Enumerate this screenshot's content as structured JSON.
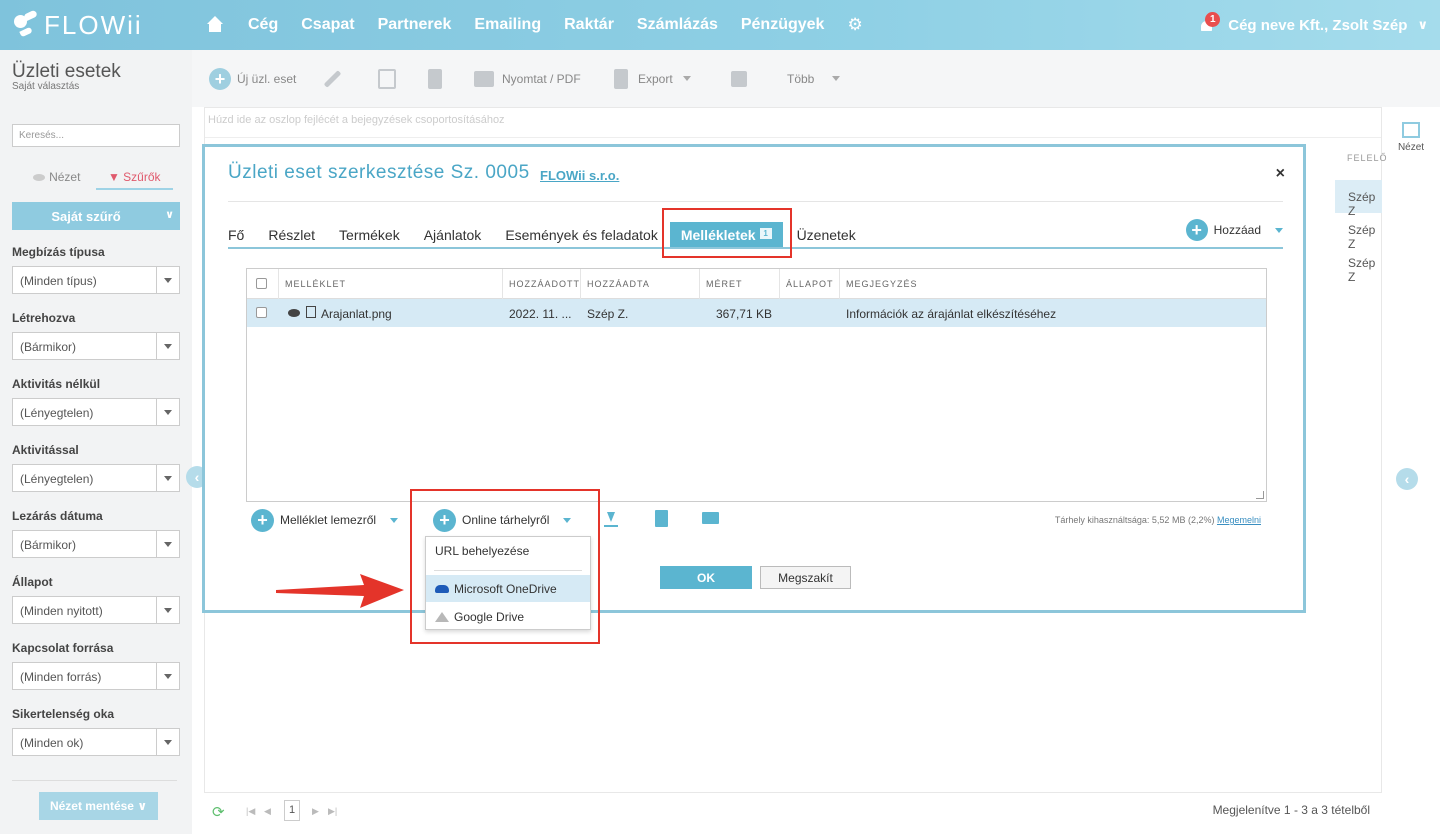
{
  "topbar": {
    "logo": "FLOWii",
    "nav": [
      "Cég",
      "Csapat",
      "Partnerek",
      "Emailing",
      "Raktár",
      "Számlázás",
      "Pénzügyek"
    ],
    "notification_count": "1",
    "user": "Cég neve Kft., Zsolt Szép"
  },
  "sidebar": {
    "title": "Üzleti esetek",
    "subtitle": "Saját választás",
    "search_placeholder": "Keresés...",
    "toggle_view": "Nézet",
    "toggle_filters": "Szűrők",
    "my_filter": "Saját szűrő",
    "filters": [
      {
        "label": "Megbízás típusa",
        "value": "(Minden típus)"
      },
      {
        "label": "Létrehozva",
        "value": "(Bármikor)"
      },
      {
        "label": "Aktivitás nélkül",
        "value": "(Lényegtelen)"
      },
      {
        "label": "Aktivitással",
        "value": "(Lényegtelen)"
      },
      {
        "label": "Lezárás dátuma",
        "value": "(Bármikor)"
      },
      {
        "label": "Állapot",
        "value": "(Minden nyitott)"
      },
      {
        "label": "Kapcsolat forrása",
        "value": "(Minden forrás)"
      },
      {
        "label": "Sikertelenség oka",
        "value": "(Minden ok)"
      }
    ],
    "save_view": "Nézet mentése"
  },
  "toolbar": {
    "new": "Új üzl. eset",
    "print": "Nyomtat / PDF",
    "export": "Export",
    "more": "Több"
  },
  "main": {
    "group_hint": "Húzd ide az oszlop fejlécét a bejegyzések csoportosításához",
    "col_header_right": "FELELŐ",
    "bg_rows": [
      "Szép Z",
      "Szép Z",
      "Szép Z"
    ],
    "right_panel_label": "Nézet",
    "footer_page": "1",
    "footer_count": "Megjelenítve 1 - 3 a 3 tételből"
  },
  "modal": {
    "title": "Üzleti eset szerkesztése Sz. 0005",
    "company": "FLOWii s.r.o.",
    "close": "×",
    "tabs": [
      "Fő",
      "Részlet",
      "Termékek",
      "Ajánlatok",
      "Események és feladatok",
      "Mellékletek",
      "Üzenetek"
    ],
    "active_tab_count": "1",
    "add_label": "Hozzáad",
    "grid": {
      "columns": [
        "MELLÉKLET",
        "HOZZÁADOTT",
        "HOZZÁADTA",
        "MÉRET",
        "ÁLLAPOT",
        "MEGJEGYZÉS"
      ],
      "rows": [
        {
          "file": "Arajanlat.png",
          "added": "2022. 11. ...",
          "added_by": "Szép Z.",
          "size": "367,71 KB",
          "status": "",
          "note": "Információk az árajánlat elkészítéséhez"
        }
      ]
    },
    "attach_disk": "Melléklet lemezről",
    "attach_online": "Online tárhelyről",
    "storage_text": "Tárhely kihasználtsága: 5,52 MB (2,2%)",
    "storage_link": "Megemelni",
    "ok": "OK",
    "cancel": "Megszakít",
    "dropdown": [
      "URL behelyezése",
      "Microsoft OneDrive",
      "Google Drive"
    ]
  },
  "colors": {
    "accent": "#5bb5d0",
    "topbar": "#8fd0e5",
    "annotation": "#e4342a"
  }
}
